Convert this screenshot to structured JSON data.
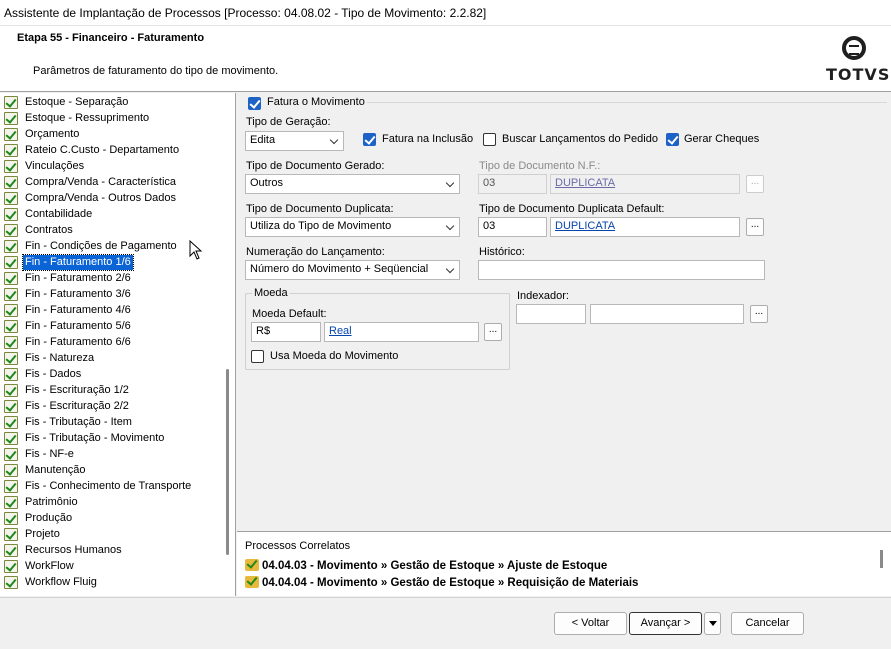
{
  "window": {
    "title": "Assistente de Implantação de Processos [Processo: 04.08.02 - Tipo de Movimento: 2.2.82]"
  },
  "header": {
    "stage": "Etapa 55 - Financeiro - Faturamento",
    "description": "Parâmetros de faturamento do tipo de movimento.",
    "logo_text": "TOTVS"
  },
  "tree": {
    "items": [
      {
        "label": "Estoque - Separação"
      },
      {
        "label": "Estoque - Ressuprimento"
      },
      {
        "label": "Orçamento"
      },
      {
        "label": "Rateio C.Custo - Departamento"
      },
      {
        "label": "Vinculações"
      },
      {
        "label": "Compra/Venda - Característica"
      },
      {
        "label": "Compra/Venda - Outros Dados"
      },
      {
        "label": "Contabilidade"
      },
      {
        "label": "Contratos"
      },
      {
        "label": "Fin - Condições de Pagamento"
      },
      {
        "label": "Fin - Faturamento 1/6"
      },
      {
        "label": "Fin - Faturamento 2/6"
      },
      {
        "label": "Fin - Faturamento 3/6"
      },
      {
        "label": "Fin - Faturamento 4/6"
      },
      {
        "label": "Fin - Faturamento 5/6"
      },
      {
        "label": "Fin - Faturamento 6/6"
      },
      {
        "label": "Fis - Natureza"
      },
      {
        "label": "Fis - Dados"
      },
      {
        "label": "Fis - Escrituração 1/2"
      },
      {
        "label": "Fis - Escrituração 2/2"
      },
      {
        "label": "Fis - Tributação - Item"
      },
      {
        "label": "Fis - Tributação - Movimento"
      },
      {
        "label": "Fis - NF-e"
      },
      {
        "label": "Manutenção"
      },
      {
        "label": "Fis - Conhecimento de Transporte"
      },
      {
        "label": "Patrimônio"
      },
      {
        "label": "Produção"
      },
      {
        "label": "Projeto"
      },
      {
        "label": "Recursos Humanos"
      },
      {
        "label": "WorkFlow"
      },
      {
        "label": "Workflow Fluig"
      }
    ],
    "selected": "Fin - Faturamento 1/6"
  },
  "form": {
    "fatura_movimento": {
      "label": "Fatura o Movimento",
      "checked": true
    },
    "tipo_geracao": {
      "label": "Tipo de Geração:",
      "value": "Edita"
    },
    "fatura_inclusao": {
      "label": "Fatura na Inclusão",
      "checked": true
    },
    "buscar_lancamentos": {
      "label": "Buscar Lançamentos do Pedido",
      "checked": false
    },
    "gerar_cheques": {
      "label": "Gerar Cheques",
      "checked": true
    },
    "tipo_doc_gerado": {
      "label": "Tipo de Documento Gerado:",
      "value": "Outros"
    },
    "tipo_doc_nf": {
      "label": "Tipo de Documento N.F.:",
      "code": "03",
      "link": "DUPLICATA"
    },
    "tipo_doc_duplicata": {
      "label": "Tipo de Documento Duplicata:",
      "value": "Utiliza do Tipo de Movimento"
    },
    "tipo_doc_dup_default": {
      "label": "Tipo de Documento Duplicata Default:",
      "code": "03",
      "link": "DUPLICATA"
    },
    "numeracao": {
      "label": "Numeração do Lançamento:",
      "value": "Número do Movimento + Seqüencial"
    },
    "historico": {
      "label": "Histórico:",
      "value": ""
    },
    "moeda": {
      "group": "Moeda",
      "default_label": "Moeda Default:",
      "code": "R$",
      "link": "Real",
      "usa_moeda": {
        "label": "Usa Moeda do Movimento",
        "checked": false
      }
    },
    "indexador": {
      "label": "Indexador:",
      "code": "",
      "desc": ""
    },
    "browse": "..."
  },
  "related": {
    "title": "Processos Correlatos",
    "items": [
      "04.04.03 - Movimento » Gestão de Estoque » Ajuste de Estoque",
      "04.04.04 - Movimento » Gestão de Estoque » Requisição de Materiais"
    ]
  },
  "footer": {
    "back": "< Voltar",
    "next": "Avançar >",
    "cancel": "Cancelar"
  }
}
